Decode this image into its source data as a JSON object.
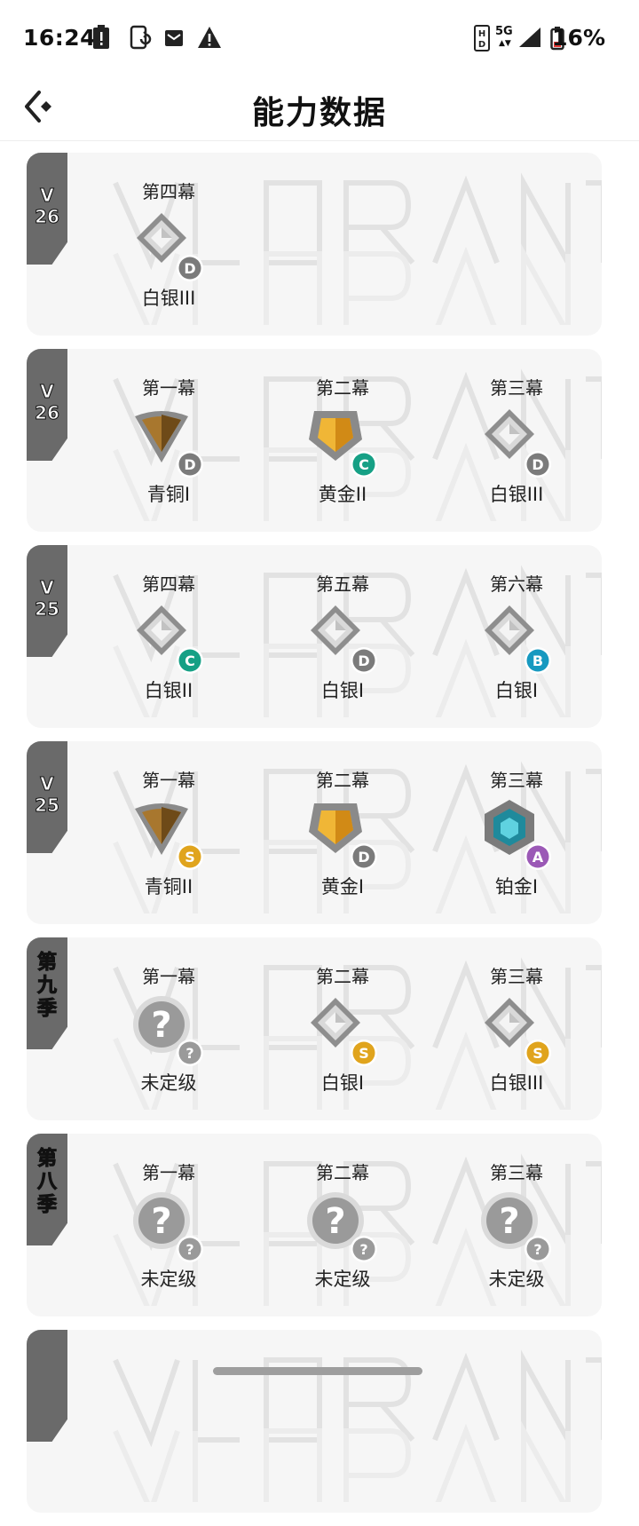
{
  "status_bar": {
    "time": "16:24",
    "network": "5G",
    "battery": "16%",
    "icons": [
      "alert-battery-icon",
      "screen-rotate-icon",
      "mail-icon",
      "warning-icon",
      "hd-icon",
      "signal-icon",
      "battery-low-icon"
    ]
  },
  "header": {
    "title": "能力数据",
    "back_icon": "back-arrow-icon"
  },
  "colors": {
    "card_bg": "#f6f6f6",
    "tag_bg": "#6a6a6a",
    "grade_D": "#7b7b7b",
    "grade_C": "#16a085",
    "grade_B": "#1799c0",
    "grade_S": "#e0a41d",
    "grade_A": "#9b59b6"
  },
  "seasons": [
    {
      "tag": "V\n26",
      "acts": [
        {
          "act": "第四幕",
          "rank": "白银III",
          "tier": "silver",
          "grade": "D"
        }
      ]
    },
    {
      "tag": "V\n26",
      "acts": [
        {
          "act": "第一幕",
          "rank": "青铜I",
          "tier": "bronze",
          "grade": "D"
        },
        {
          "act": "第二幕",
          "rank": "黄金II",
          "tier": "gold",
          "grade": "C"
        },
        {
          "act": "第三幕",
          "rank": "白银III",
          "tier": "silver",
          "grade": "D"
        }
      ]
    },
    {
      "tag": "V\n25",
      "acts": [
        {
          "act": "第四幕",
          "rank": "白银II",
          "tier": "silver",
          "grade": "C"
        },
        {
          "act": "第五幕",
          "rank": "白银I",
          "tier": "silver",
          "grade": "D"
        },
        {
          "act": "第六幕",
          "rank": "白银I",
          "tier": "silver",
          "grade": "B"
        }
      ]
    },
    {
      "tag": "V\n25",
      "acts": [
        {
          "act": "第一幕",
          "rank": "青铜II",
          "tier": "bronze",
          "grade": "S"
        },
        {
          "act": "第二幕",
          "rank": "黄金I",
          "tier": "gold",
          "grade": "D"
        },
        {
          "act": "第三幕",
          "rank": "铂金I",
          "tier": "platinum",
          "grade": "A"
        }
      ]
    },
    {
      "tag": "第\n九\n季",
      "acts": [
        {
          "act": "第一幕",
          "rank": "未定级",
          "tier": "unranked",
          "grade": "?"
        },
        {
          "act": "第二幕",
          "rank": "白银I",
          "tier": "silver",
          "grade": "S"
        },
        {
          "act": "第三幕",
          "rank": "白银III",
          "tier": "silver",
          "grade": "S"
        }
      ]
    },
    {
      "tag": "第\n八\n季",
      "acts": [
        {
          "act": "第一幕",
          "rank": "未定级",
          "tier": "unranked",
          "grade": "?"
        },
        {
          "act": "第二幕",
          "rank": "未定级",
          "tier": "unranked",
          "grade": "?"
        },
        {
          "act": "第三幕",
          "rank": "未定级",
          "tier": "unranked",
          "grade": "?"
        }
      ]
    },
    {
      "tag": "",
      "acts": []
    }
  ]
}
